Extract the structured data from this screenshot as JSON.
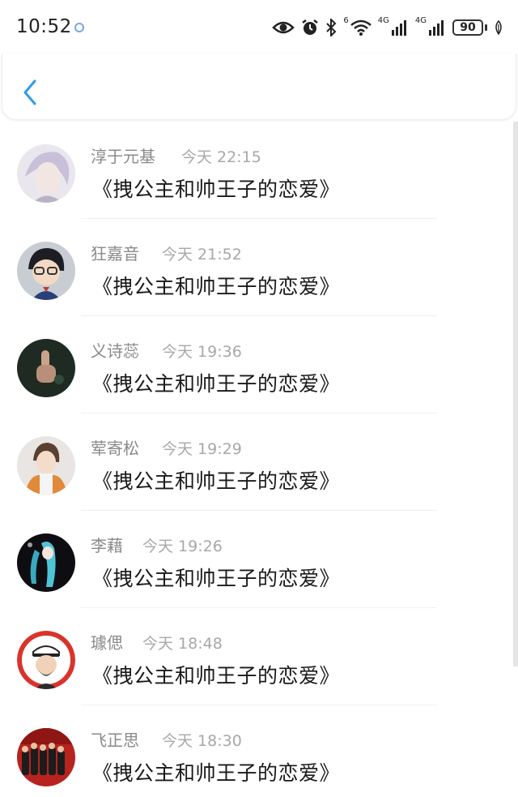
{
  "status_bar": {
    "time": "10:52",
    "network_left": "4G",
    "network_right": "4G",
    "wifi_label": "6",
    "battery": "90"
  },
  "header": {
    "back_icon": "chevron-left-icon",
    "accent_color": "#2f9be8"
  },
  "list": [
    {
      "name": "淳于元基",
      "time": "今天 22:15",
      "message": "《拽公主和帅王子的恋爱》",
      "avatar": "avatar-white-hair"
    },
    {
      "name": "狂嘉音",
      "time": "今天 21:52",
      "message": "《拽公主和帅王子的恋爱》",
      "avatar": "avatar-conan"
    },
    {
      "name": "义诗蕊",
      "time": "今天 19:36",
      "message": "《拽公主和帅王子的恋爱》",
      "avatar": "avatar-dark-hand"
    },
    {
      "name": "荤寄松",
      "time": "今天 19:29",
      "message": "《拽公主和帅王子的恋爱》",
      "avatar": "avatar-young-man"
    },
    {
      "name": "李藉",
      "time": "今天 19:26",
      "message": "《拽公主和帅王子的恋爱》",
      "avatar": "avatar-miku"
    },
    {
      "name": "璩偲",
      "time": "今天 18:48",
      "message": "《拽公主和帅王子的恋爱》",
      "avatar": "avatar-captain"
    },
    {
      "name": "飞正思",
      "time": "今天 18:30",
      "message": "《拽公主和帅王子的恋爱》",
      "avatar": "avatar-group"
    }
  ]
}
